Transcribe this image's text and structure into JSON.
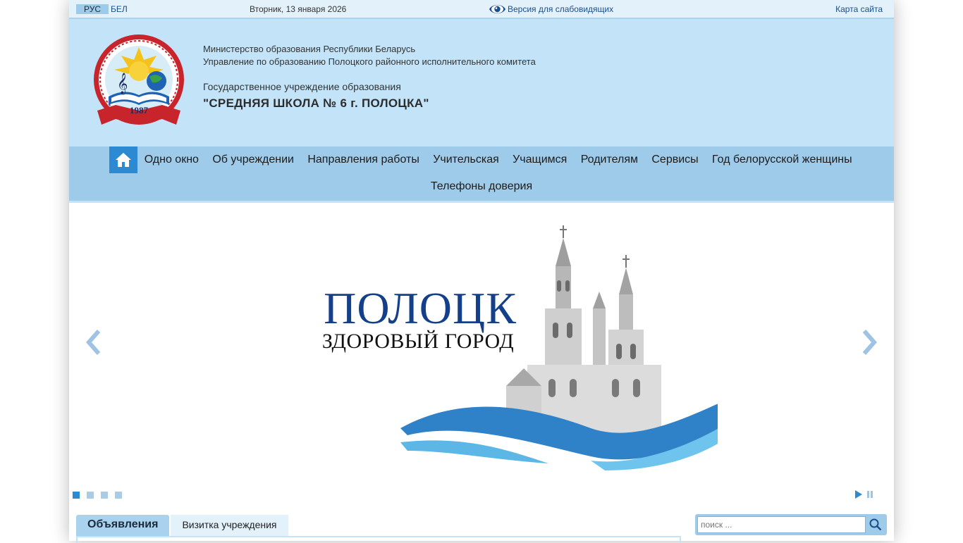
{
  "topbar": {
    "lang_ru": "РУС",
    "lang_be": "БЕЛ",
    "date": "Вторник, 13 января 2026",
    "low_vision": "Версия для слабовидящих",
    "sitemap": "Карта сайта"
  },
  "header": {
    "ministry_line1": "Министерство образования Республики Беларусь",
    "ministry_line2": "Управление по образованию Полоцкого районного исполнительного комитета",
    "institution_type": "Государственное учреждение образования",
    "institution_name": "\"СРЕДНЯЯ ШКОЛА № 6 г. ПОЛОЦКА\"",
    "logo_year": "1987"
  },
  "nav": {
    "home_icon": "home-icon",
    "items": [
      "Одно окно",
      "Об учреждении",
      "Направления работы",
      "Учительская",
      "Учащимся",
      "Родителям",
      "Сервисы",
      "Год белорусской женщины"
    ],
    "row2": [
      "Телефоны доверия"
    ]
  },
  "slider": {
    "title": "ПОЛОЦК",
    "subtitle": "ЗДОРОВЫЙ ГОРОД",
    "slide_count": 4,
    "active_slide": 1
  },
  "tabs": {
    "active": "Объявления",
    "inactive": "Визитка учреждения"
  },
  "search": {
    "placeholder": "поиск ..."
  },
  "colors": {
    "header_bg": "#c3e4f8",
    "nav_bg": "#9fcbea",
    "accent": "#2b8ad1",
    "link": "#1a4f8a"
  }
}
